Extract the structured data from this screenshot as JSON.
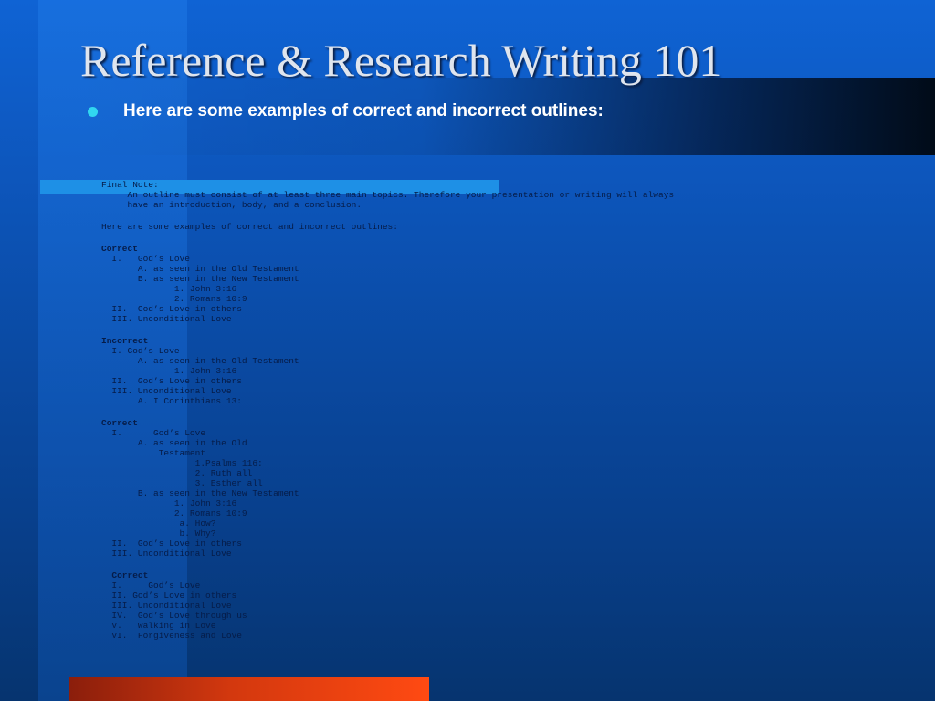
{
  "slide": {
    "title": "Reference & Research Writing 101",
    "bullet": "Here are some examples of correct and incorrect outlines:"
  },
  "colors": {
    "background_top": "#0f63d4",
    "background_bottom": "#06346f",
    "title_text": "#dfe5ee",
    "bullet_dot": "#31d7f0",
    "bullet_text": "#ffffff",
    "highlight_bar": "#1e90e6",
    "outline_text": "#061c48",
    "accent_bar": "#ff4a12"
  },
  "outline_lines": [
    {
      "text": "Final Note:",
      "bold": false,
      "gap": false
    },
    {
      "text": "     An outline must consist of at least three main topics. Therefore your presentation or writing will always",
      "bold": false,
      "gap": false
    },
    {
      "text": "     have an introduction, body, and a conclusion.",
      "bold": false,
      "gap": false
    },
    {
      "text": "Here are some examples of correct and incorrect outlines:",
      "bold": false,
      "gap": true
    },
    {
      "text": "Correct",
      "bold": true,
      "gap": true
    },
    {
      "text": "  I.   God’s Love",
      "bold": false,
      "gap": false
    },
    {
      "text": "       A. as seen in the Old Testament",
      "bold": false,
      "gap": false
    },
    {
      "text": "       B. as seen in the New Testament",
      "bold": false,
      "gap": false
    },
    {
      "text": "              1. John 3:16",
      "bold": false,
      "gap": false
    },
    {
      "text": "              2. Romans 10:9",
      "bold": false,
      "gap": false
    },
    {
      "text": "  II.  God’s Love in others",
      "bold": false,
      "gap": false
    },
    {
      "text": "  III. Unconditional Love",
      "bold": false,
      "gap": false
    },
    {
      "text": "Incorrect",
      "bold": true,
      "gap": true
    },
    {
      "text": "  I. God’s Love",
      "bold": false,
      "gap": false
    },
    {
      "text": "       A. as seen in the Old Testament",
      "bold": false,
      "gap": false
    },
    {
      "text": "              1. John 3:16",
      "bold": false,
      "gap": false
    },
    {
      "text": "  II.  God’s Love in others",
      "bold": false,
      "gap": false
    },
    {
      "text": "  III. Unconditional Love",
      "bold": false,
      "gap": false
    },
    {
      "text": "       A. I Corinthians 13:",
      "bold": false,
      "gap": false
    },
    {
      "text": "Correct",
      "bold": true,
      "gap": true
    },
    {
      "text": "  I.      God’s Love",
      "bold": false,
      "gap": false
    },
    {
      "text": "       A. as seen in the Old",
      "bold": false,
      "gap": false
    },
    {
      "text": "           Testament",
      "bold": false,
      "gap": false
    },
    {
      "text": "                  1.Psalms 116:",
      "bold": false,
      "gap": false
    },
    {
      "text": "                  2. Ruth all",
      "bold": false,
      "gap": false
    },
    {
      "text": "                  3. Esther all",
      "bold": false,
      "gap": false
    },
    {
      "text": "       B. as seen in the New Testament",
      "bold": false,
      "gap": false
    },
    {
      "text": "              1. John 3:16",
      "bold": false,
      "gap": false
    },
    {
      "text": "              2. Romans 10:9",
      "bold": false,
      "gap": false
    },
    {
      "text": "               a. How?",
      "bold": false,
      "gap": false
    },
    {
      "text": "               b. Why?",
      "bold": false,
      "gap": false
    },
    {
      "text": "  II.  God’s Love in others",
      "bold": false,
      "gap": false
    },
    {
      "text": "  III. Unconditional Love",
      "bold": false,
      "gap": false
    },
    {
      "text": "  Correct",
      "bold": true,
      "gap": true
    },
    {
      "text": "  I.     God’s Love",
      "bold": false,
      "gap": false
    },
    {
      "text": "  II. God’s Love in others",
      "bold": false,
      "gap": false
    },
    {
      "text": "  III. Unconditional Love",
      "bold": false,
      "gap": false
    },
    {
      "text": "  IV.  God’s Love through us",
      "bold": false,
      "gap": false
    },
    {
      "text": "  V.   Walking in Love",
      "bold": false,
      "gap": false
    },
    {
      "text": "  VI.  Forgiveness and Love",
      "bold": false,
      "gap": false
    }
  ]
}
